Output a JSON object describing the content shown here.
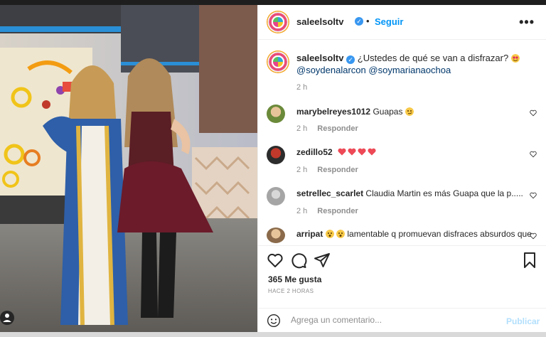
{
  "post": {
    "username": "saleelsoltv",
    "follow_label": "Seguir",
    "more_label": "•••",
    "caption_text": "¿Ustedes de qué se van a disfrazar?",
    "mentions": [
      "@soydenalarcon",
      "@soymarianaochoa"
    ],
    "caption_time": "2 h",
    "likes": "365 Me gusta",
    "posted_ago": "HACE 2 HORAS"
  },
  "comments": [
    {
      "user": "marybelreyes1012",
      "text": "Guapas",
      "emoji": "smirk-face",
      "time": "2 h",
      "reply": "Responder"
    },
    {
      "user": "zedillo52",
      "text": "",
      "emoji": "four-red-hearts",
      "time": "2 h",
      "reply": "Responder"
    },
    {
      "user": "setrellec_scarlet",
      "text": "Claudia Martin es más Guapa que la p.....",
      "time": "2 h",
      "reply": "Responder"
    },
    {
      "user": "arripat",
      "text": "lamentable q promuevan disfraces absurdos que",
      "emoji": "frowning-faces"
    }
  ],
  "add_comment": {
    "placeholder": "Agrega un comentario...",
    "publish_label": "Publicar"
  },
  "colors": {
    "link": "#0095f6",
    "tag": "#00376b",
    "muted": "#8e8e8e",
    "text": "#262626",
    "heart_red": "#ed4956"
  }
}
